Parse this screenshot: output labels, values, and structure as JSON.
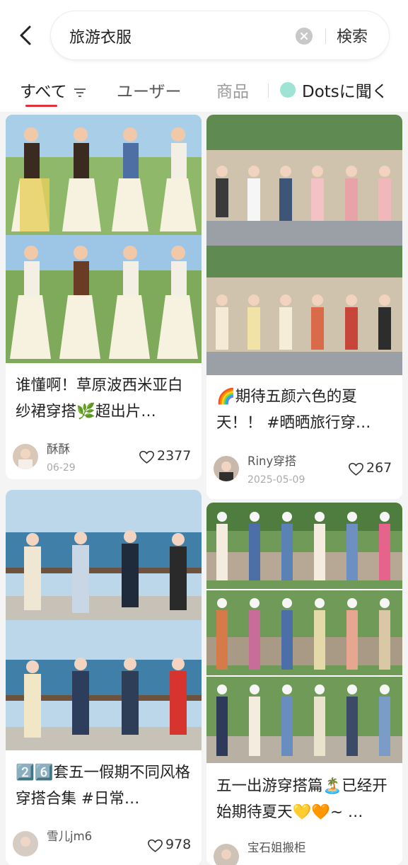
{
  "search": {
    "query": "旅游衣服",
    "button_label": "検索"
  },
  "tabs": [
    {
      "label": "すべて"
    },
    {
      "label": "ユーザー"
    },
    {
      "label": "商品"
    },
    {
      "label": "Dotsに聞く"
    }
  ],
  "colors": {
    "accent": "#e0303a",
    "dots": "#9ee3d3"
  },
  "icons": [
    "back-arrow-icon",
    "clear-icon",
    "filter-icon",
    "dots-icon",
    "heart-icon"
  ],
  "cards": [
    {
      "title": "谁懂啊！草原波西米亚白纱裙穿搭🌿超出片…",
      "author": "酥酥",
      "date": "06-29",
      "likes": "2377"
    },
    {
      "title": "🌈期待五颜六色的夏天！！ #晒晒旅行穿…",
      "author": "Riny穿搭",
      "date": "2025-05-09",
      "likes": "267"
    },
    {
      "title": "2️⃣6️⃣套五一假期不同风格穿搭合集 #日常…",
      "author": "雪儿jm6",
      "date": "",
      "likes": "978"
    },
    {
      "title": "五一出游穿搭篇🏝️已经开始期待夏天💛🧡~ …",
      "author": "宝石姐搬柜",
      "date": "",
      "likes": ""
    }
  ]
}
